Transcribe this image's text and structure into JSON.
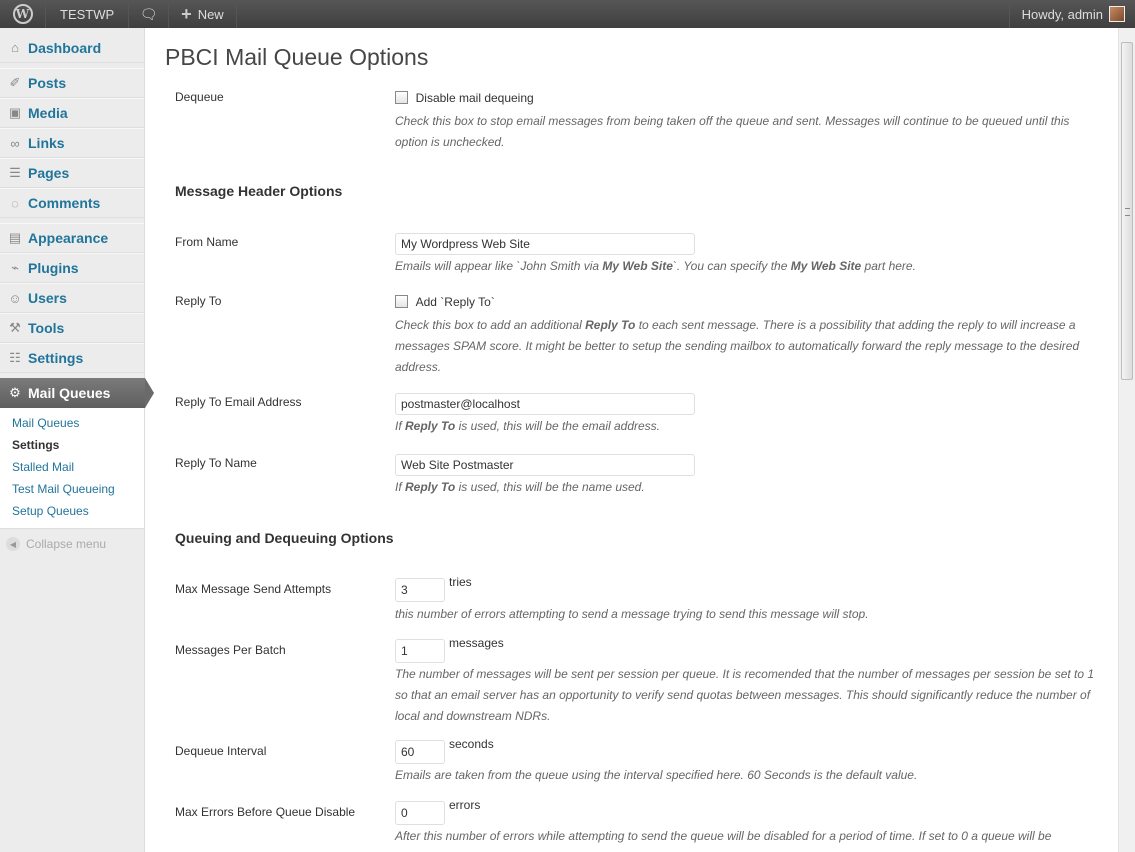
{
  "adminbar": {
    "site_name": "TESTWP",
    "new_label": "New",
    "howdy": "Howdy, admin"
  },
  "sidebar": {
    "items": [
      {
        "label": "Dashboard",
        "icon": "home-icon"
      },
      {
        "label": "Posts",
        "icon": "pin-icon"
      },
      {
        "label": "Media",
        "icon": "media-icon"
      },
      {
        "label": "Links",
        "icon": "link-icon"
      },
      {
        "label": "Pages",
        "icon": "pages-icon"
      },
      {
        "label": "Comments",
        "icon": "comment-icon"
      },
      {
        "label": "Appearance",
        "icon": "appearance-icon"
      },
      {
        "label": "Plugins",
        "icon": "plugin-icon"
      },
      {
        "label": "Users",
        "icon": "users-icon"
      },
      {
        "label": "Tools",
        "icon": "tools-icon"
      },
      {
        "label": "Settings",
        "icon": "settings-icon"
      }
    ],
    "active": {
      "label": "Mail Queues",
      "icon": "gear-icon"
    },
    "submenu": [
      "Mail Queues",
      "Settings",
      "Stalled Mail",
      "Test Mail Queueing",
      "Setup Queues"
    ],
    "collapse_label": "Collapse menu"
  },
  "page": {
    "title": "PBCI Mail Queue Options",
    "dequeue": {
      "label": "Dequeue",
      "checkbox_label": "Disable mail dequeing",
      "checked": false,
      "desc": "Check this box to stop email messages from being taken off the queue and sent. Messages will continue to be queued until this option is unchecked."
    },
    "section_header": "Message Header Options",
    "from_name": {
      "label": "From Name",
      "value": "My Wordpress Web Site",
      "desc_1": "Emails will appear like `John Smith via ",
      "desc_bold_1": "My Web Site",
      "desc_2": "`. You can specify the ",
      "desc_bold_2": "My Web Site",
      "desc_3": " part here."
    },
    "reply_to": {
      "label": "Reply To",
      "checkbox_label": "Add `Reply To`",
      "checked": false,
      "desc_1": "Check this box to add an additional ",
      "desc_bold": "Reply To",
      "desc_2": " to each sent message. There is a possibility that adding the reply to will increase a messages SPAM score. It might be better to setup the sending mailbox to automatically forward the reply message to the desired address."
    },
    "reply_to_email": {
      "label": "Reply To Email Address",
      "value": "postmaster@localhost",
      "desc_1": "If ",
      "desc_bold": "Reply To",
      "desc_2": " is used, this will be the email address."
    },
    "reply_to_name": {
      "label": "Reply To Name",
      "value": "Web Site Postmaster",
      "desc_1": "If ",
      "desc_bold": "Reply To",
      "desc_2": " is used, this will be the name used."
    },
    "section_queue": "Queuing and Dequeuing Options",
    "max_attempts": {
      "label": "Max Message Send Attempts",
      "value": "3",
      "unit": "tries",
      "desc": "this number of errors attempting to send a message trying to send this message will stop."
    },
    "per_batch": {
      "label": "Messages Per Batch",
      "value": "1",
      "unit": "messages",
      "desc": "The number of messages will be sent per session per queue. It is recomended that the number of messages per session be set to 1 so that an email server has an opportunity to verify send quotas between messages. This should significantly reduce the number of local and downstream NDRs."
    },
    "interval": {
      "label": "Dequeue Interval",
      "value": "60",
      "unit": "seconds",
      "desc": "Emails are taken from the queue using the interval specified here. 60 Seconds is the default value."
    },
    "max_errors": {
      "label": "Max Errors Before Queue Disable",
      "value": "0",
      "unit": "errors",
      "desc": "After this number of errors while attempting to send the queue will be disabled for a period of time. If set to 0 a queue will be"
    }
  }
}
